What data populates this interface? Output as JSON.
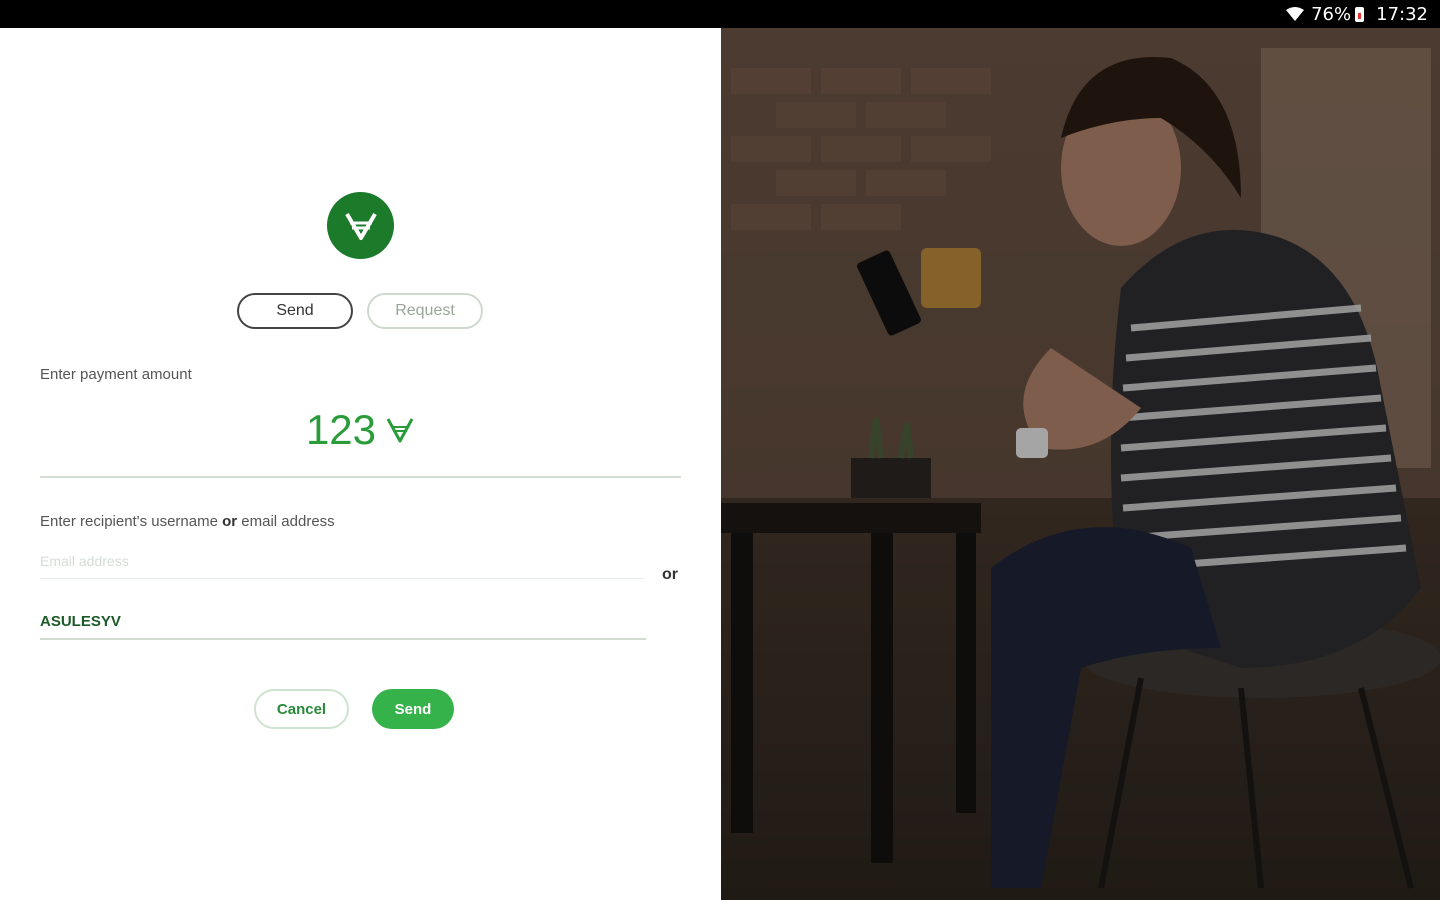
{
  "status_bar": {
    "battery": "76%",
    "time": "17:32"
  },
  "logo": {
    "icon": "currency-logo-icon"
  },
  "mode_toggle": {
    "send_label": "Send",
    "request_label": "Request"
  },
  "payment": {
    "amount_label": "Enter payment amount",
    "amount_value": "123"
  },
  "recipient": {
    "label_part1": "Enter recipient's username ",
    "label_or": "or",
    "label_part2": " email address",
    "email_placeholder": "Email address",
    "or_separator": "or",
    "username_value": "ASULESYV"
  },
  "actions": {
    "cancel_label": "Cancel",
    "send_label": "Send"
  },
  "colors": {
    "brand_dark": "#1c7a2b",
    "brand_green": "#36b24a",
    "amount_green": "#2a9d3a"
  }
}
